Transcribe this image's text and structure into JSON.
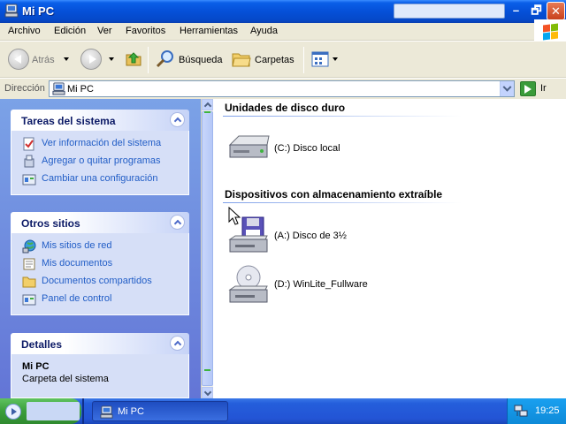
{
  "window": {
    "title": "Mi PC",
    "controls": {
      "minimize": "–",
      "maximize": "🗗",
      "close": "✕"
    }
  },
  "menu": [
    "Archivo",
    "Edición",
    "Ver",
    "Favoritos",
    "Herramientas",
    "Ayuda"
  ],
  "toolbar": {
    "back": "Atrás",
    "search": "Búsqueda",
    "folders": "Carpetas"
  },
  "address": {
    "label": "Dirección",
    "value": "Mi PC",
    "go": "Ir"
  },
  "taskpane": {
    "system_tasks": {
      "title": "Tareas del sistema",
      "links": [
        "Ver información del sistema",
        "Agregar o quitar programas",
        "Cambiar una configuración"
      ]
    },
    "other_places": {
      "title": "Otros sitios",
      "links": [
        "Mis sitios de red",
        "Mis documentos",
        "Documentos compartidos",
        "Panel de control"
      ]
    },
    "details": {
      "title": "Detalles",
      "name": "Mi PC",
      "type": "Carpeta del sistema"
    }
  },
  "content": {
    "hard_drives": {
      "title": "Unidades de disco duro",
      "items": [
        "(C:) Disco local"
      ]
    },
    "removable": {
      "title": "Dispositivos con almacenamiento extraíble",
      "items": [
        "(A:) Disco de 3½",
        "(D:) WinLite_Fullware"
      ]
    }
  },
  "taskbar": {
    "window_button": "Mi PC",
    "clock": "19:25"
  },
  "colors": {
    "titlebar": "#0550d8",
    "taskpane_bg": "#6f8ddd",
    "link": "#215dc6",
    "start_green": "#3a9e3a"
  }
}
